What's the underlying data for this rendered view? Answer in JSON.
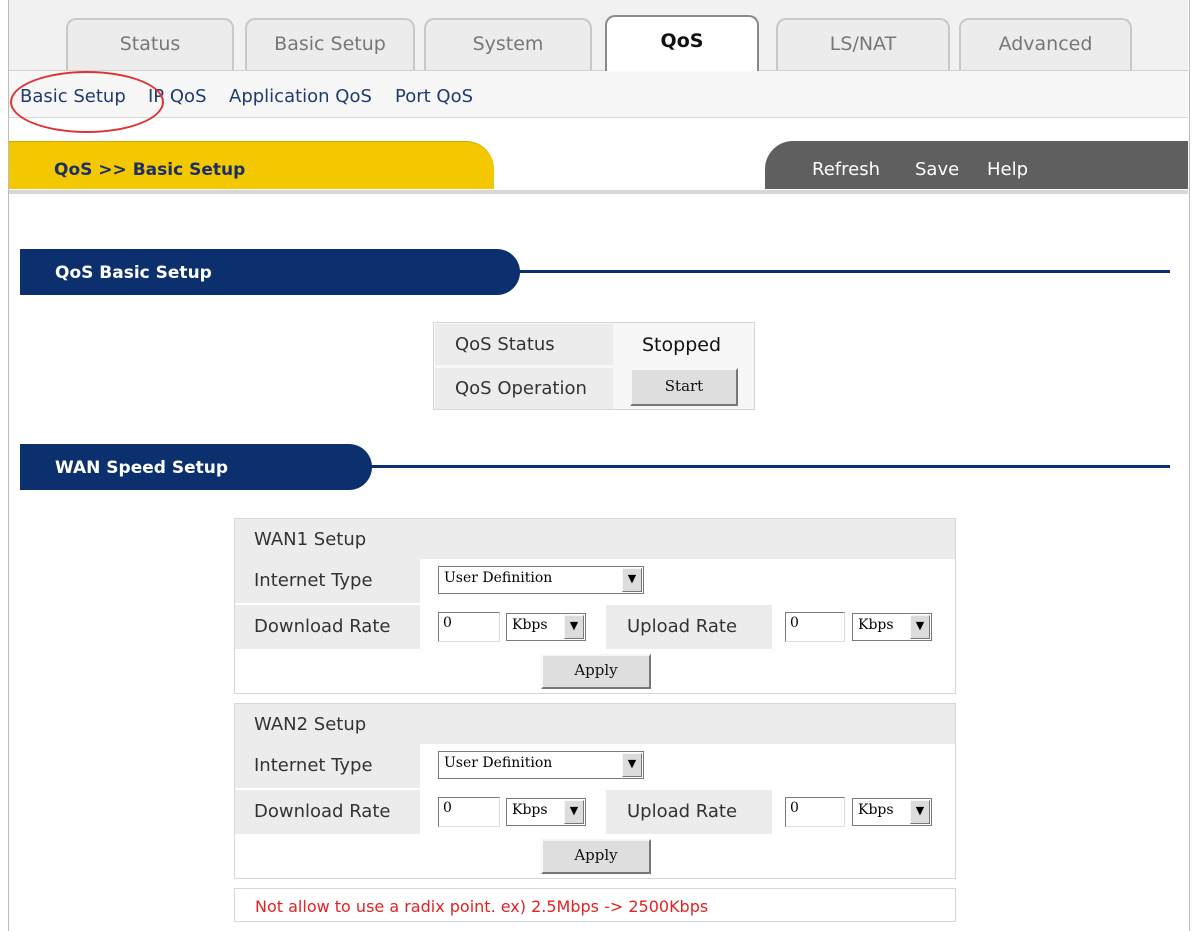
{
  "tabs": [
    {
      "label": "Status",
      "active": false
    },
    {
      "label": "Basic Setup",
      "active": false
    },
    {
      "label": "System",
      "active": false
    },
    {
      "label": "QoS",
      "active": true
    },
    {
      "label": "LS/NAT",
      "active": false
    },
    {
      "label": "Advanced",
      "active": false
    }
  ],
  "submenu": [
    "Basic Setup",
    "IP QoS",
    "Application QoS",
    "Port QoS"
  ],
  "breadcrumb": "QoS >> Basic Setup",
  "actions": {
    "refresh": "Refresh",
    "save": "Save",
    "help": "Help"
  },
  "qos_section": {
    "title": "QoS Basic Setup",
    "status_label": "QoS Status",
    "status_value": "Stopped",
    "operation_label": "QoS Operation",
    "start_button": "Start"
  },
  "wan_section": {
    "title": "WAN Speed Setup",
    "wan1": {
      "title": "WAN1 Setup",
      "internet_type_label": "Internet Type",
      "internet_type": "User Definition",
      "download_label": "Download Rate",
      "download_value": "0",
      "download_unit": "Kbps",
      "upload_label": "Upload Rate",
      "upload_value": "0",
      "upload_unit": "Kbps",
      "apply": "Apply"
    },
    "wan2": {
      "title": "WAN2 Setup",
      "internet_type_label": "Internet Type",
      "internet_type": "User Definition",
      "download_label": "Download Rate",
      "download_value": "0",
      "download_unit": "Kbps",
      "upload_label": "Upload Rate",
      "upload_value": "0",
      "upload_unit": "Kbps",
      "apply": "Apply"
    },
    "note": "Not allow to use a radix point. ex) 2.5Mbps -> 2500Kbps"
  },
  "colors": {
    "accent_yellow": "#f3c800",
    "section_blue": "#0c2f6e",
    "note_red": "#e02323",
    "highlight_circle": "#d33333"
  }
}
